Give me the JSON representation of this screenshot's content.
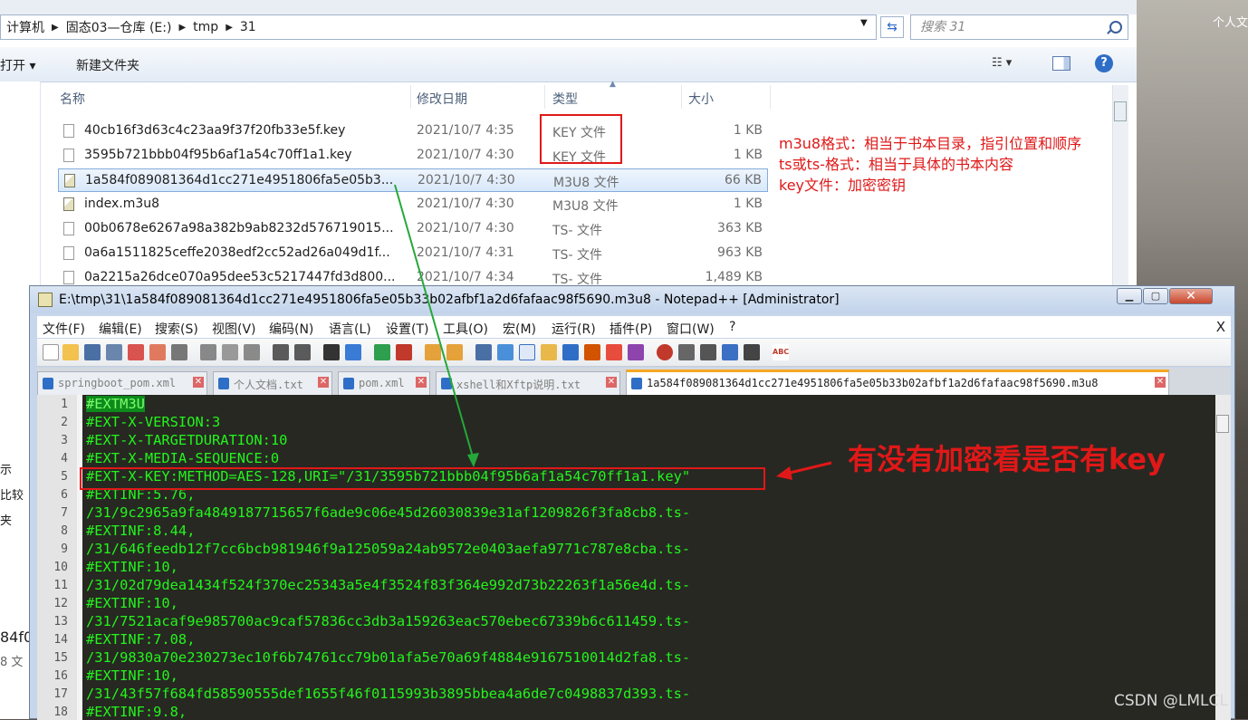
{
  "desktop": {
    "label": "个人文"
  },
  "explorer": {
    "breadcrumbs": [
      "计算机",
      "固态03—仓库 (E:)",
      "tmp",
      "31"
    ],
    "search_placeholder": "搜索 31",
    "toolbar": {
      "open_label": "打开 ▾",
      "new_folder_label": "新建文件夹"
    },
    "columns": {
      "name": "名称",
      "date": "修改日期",
      "type": "类型",
      "size": "大小"
    },
    "left_pane": [
      "示",
      "比较",
      "夹",
      "84f0",
      "8 文"
    ],
    "files": [
      {
        "name": "40cb16f3d63c4c23aa9f37f20fb33e5f.key",
        "date": "2021/10/7 4:35",
        "type": "KEY 文件",
        "size": "1 KB",
        "icon": "key-file"
      },
      {
        "name": "3595b721bbb04f95b6af1a54c70ff1a1.key",
        "date": "2021/10/7 4:30",
        "type": "KEY 文件",
        "size": "1 KB",
        "icon": "key-file"
      },
      {
        "name": "1a584f089081364d1cc271e4951806fa5e05b3...",
        "date": "2021/10/7 4:30",
        "type": "M3U8 文件",
        "size": "66 KB",
        "icon": "m3u8-file",
        "selected": true
      },
      {
        "name": "index.m3u8",
        "date": "2021/10/7 4:30",
        "type": "M3U8 文件",
        "size": "1 KB",
        "icon": "m3u8-file"
      },
      {
        "name": "00b0678e6267a98a382b9ab8232d576719015...",
        "date": "2021/10/7 4:30",
        "type": "TS- 文件",
        "size": "363 KB",
        "icon": "ts-file"
      },
      {
        "name": "0a6a1511825ceffe2038edf2cc52ad26a049d1f...",
        "date": "2021/10/7 4:31",
        "type": "TS- 文件",
        "size": "963 KB",
        "icon": "ts-file"
      },
      {
        "name": "0a2215a26dce070a95dee53c5217447fd3d800...",
        "date": "2021/10/7 4:34",
        "type": "TS- 文件",
        "size": "1,489 KB",
        "icon": "ts-file"
      }
    ],
    "notes": [
      "m3u8格式：相当于书本目录，指引位置和顺序",
      "ts或ts-格式：相当于具体的书本内容",
      "key文件：加密密钥"
    ]
  },
  "notepad": {
    "title": "E:\\tmp\\31\\1a584f089081364d1cc271e4951806fa5e05b33b02afbf1a2d6fafaac98f5690.m3u8 - Notepad++ [Administrator]",
    "menu": [
      "文件(F)",
      "编辑(E)",
      "搜索(S)",
      "视图(V)",
      "编码(N)",
      "语言(L)",
      "设置(T)",
      "工具(O)",
      "宏(M)",
      "运行(R)",
      "插件(P)",
      "窗口(W)",
      "?"
    ],
    "menu_close": "X",
    "tabs": [
      {
        "label": "springboot_pom.xml",
        "active": false
      },
      {
        "label": "个人文档.txt",
        "active": false
      },
      {
        "label": "pom.xml",
        "active": false
      },
      {
        "label": "xshell和Xftp说明.txt",
        "active": false
      },
      {
        "label": "1a584f089081364d1cc271e4951806fa5e05b33b02afbf1a2d6fafaac98f5690.m3u8",
        "active": true
      }
    ],
    "lines": [
      {
        "n": "1",
        "text": "#EXTM3U"
      },
      {
        "n": "2",
        "text": "#EXT-X-VERSION:3"
      },
      {
        "n": "3",
        "text": "#EXT-X-TARGETDURATION:10"
      },
      {
        "n": "4",
        "text": "#EXT-X-MEDIA-SEQUENCE:0"
      },
      {
        "n": "5",
        "text": "#EXT-X-KEY:METHOD=AES-128,URI=\"/31/3595b721bbb04f95b6af1a54c70ff1a1.key\""
      },
      {
        "n": "6",
        "text": "#EXTINF:5.76,"
      },
      {
        "n": "7",
        "text": "/31/9c2965a9fa4849187715657f6ade9c06e45d26030839e31af1209826f3fa8cb8.ts-"
      },
      {
        "n": "8",
        "text": "#EXTINF:8.44,"
      },
      {
        "n": "9",
        "text": "/31/646feedb12f7cc6bcb981946f9a125059a24ab9572e0403aefa9771c787e8cba.ts-"
      },
      {
        "n": "10",
        "text": "#EXTINF:10,"
      },
      {
        "n": "11",
        "text": "/31/02d79dea1434f524f370ec25343a5e4f3524f83f364e992d73b22263f1a56e4d.ts-"
      },
      {
        "n": "12",
        "text": "#EXTINF:10,"
      },
      {
        "n": "13",
        "text": "/31/7521acaf9e985700ac9caf57836cc3db3a159263eac570ebec67339b6c611459.ts-"
      },
      {
        "n": "14",
        "text": "#EXTINF:7.08,"
      },
      {
        "n": "15",
        "text": "/31/9830a70e230273ec10f6b74761cc79b01afa5e70a69f4884e9167510014d2fa8.ts-"
      },
      {
        "n": "16",
        "text": "#EXTINF:10,"
      },
      {
        "n": "17",
        "text": "/31/43f57f684fd58590555def1655f46f0115993b3895bbea4a6de7c0498837d393.ts-"
      },
      {
        "n": "18",
        "text": "#EXTINF:9.8,"
      }
    ]
  },
  "annotation": {
    "key_note": "有没有加密看是否有key"
  },
  "watermark": "CSDN @LMLCL",
  "colors": {
    "annotation_red": "#e01818",
    "arrow_green": "#25a83a",
    "editor_bg": "#272822",
    "code_green": "#23f51c"
  }
}
